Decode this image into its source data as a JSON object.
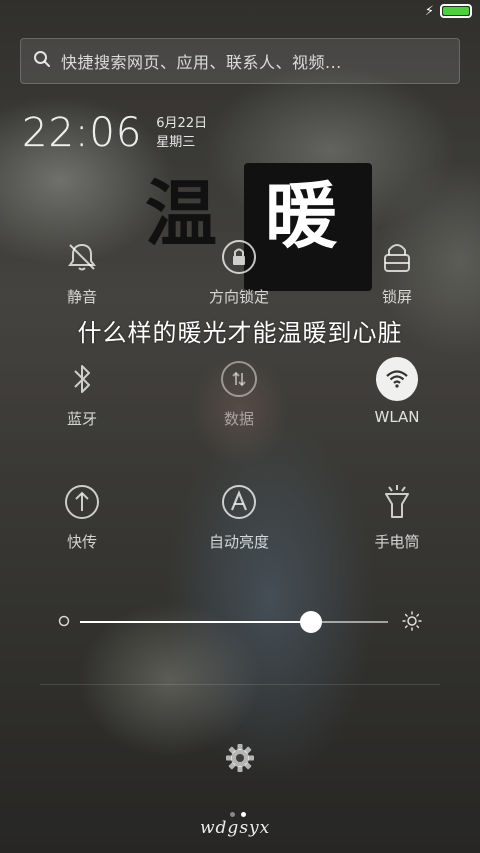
{
  "status_bar": {
    "battery_level": 1.0,
    "charging_icon": "lightning-bolt-icon",
    "battery_color": "#4cd13a"
  },
  "search": {
    "placeholder": "快捷搜索网页、应用、联系人、视频..."
  },
  "clock": {
    "time": "22:06",
    "date": "6月22日",
    "weekday": "星期三"
  },
  "overlay_title": {
    "char1": "温",
    "char2": "暖",
    "subtitle": "什么样的暖光才能温暖到心脏"
  },
  "toggles": [
    {
      "label": "静音",
      "icon": "bell-muted-icon",
      "active": false
    },
    {
      "label": "方向锁定",
      "icon": "rotation-lock-icon",
      "active": false
    },
    {
      "label": "锁屏",
      "icon": "lock-icon",
      "active": false
    },
    {
      "label": "蓝牙",
      "icon": "bluetooth-icon",
      "active": false
    },
    {
      "label": "数据",
      "icon": "mobile-data-icon",
      "active": false
    },
    {
      "label": "WLAN",
      "icon": "wifi-icon",
      "active": true
    },
    {
      "label": "快传",
      "icon": "upload-arrow-icon",
      "active": false
    },
    {
      "label": "自动亮度",
      "icon": "auto-brightness-icon",
      "active": false
    },
    {
      "label": "手电筒",
      "icon": "flashlight-icon",
      "active": false
    }
  ],
  "brightness": {
    "level": 0.75
  },
  "settings": {
    "icon": "gear-icon"
  },
  "pager": {
    "pages": 2,
    "current": 2
  },
  "watermark": "wdgsyx"
}
